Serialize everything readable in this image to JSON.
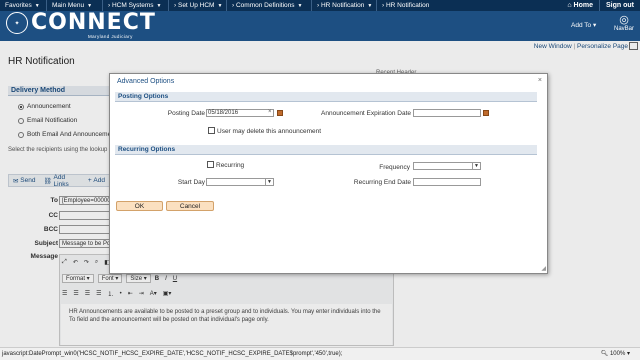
{
  "topnav": {
    "crumbs": [
      "Favorites",
      "Main Menu",
      "HCM Systems",
      "Set Up HCM",
      "Common Definitions",
      "HR Notification",
      "HR Notification"
    ],
    "home": "Home",
    "signout": "Sign out"
  },
  "banner": {
    "logo_text": "CONNECT",
    "logo_sub": "Maryland Judiciary",
    "add_to": "Add To",
    "navbar": "NavBar"
  },
  "links": {
    "new_window": "New Window",
    "personalize": "Personalize Page"
  },
  "page": {
    "title": "HR Notification",
    "delivery_method": "Delivery Method",
    "radio_announcement": "Announcement",
    "radio_email": "Email Notification",
    "radio_both": "Both Email And Announceme",
    "recipients_text": "Select the recipients using the lookup",
    "send": "Send",
    "add_links": "Add Links",
    "add": "Add",
    "to_label": "To",
    "to_value": "[Employee=00000",
    "cc_label": "CC",
    "bcc_label": "BCC",
    "subject_label": "Subject",
    "subject_value": "Message to be Po",
    "message_label": "Message",
    "editor": {
      "format": "Format",
      "font": "Font",
      "size": "Size",
      "body": "HR Announcements are available to be posted to a preset group and to individuals. You may enter individuals into the To field and the announcement will be posted on that individual's page only."
    },
    "partial_header": "Recent Header"
  },
  "modal": {
    "title": "Advanced Options",
    "close": "×",
    "posting_section": "Posting Options",
    "posting_date_label": "Posting Date",
    "posting_date_value": "05/18/2016",
    "expiration_label": "Announcement Expiration Date",
    "expiration_value": "",
    "user_delete_label": "User may delete this announcement",
    "recurring_section": "Recurring Options",
    "recurring_label": "Recurring",
    "frequency_label": "Frequency",
    "start_day_label": "Start Day",
    "end_date_label": "Recurring End Date",
    "ok": "OK",
    "cancel": "Cancel"
  },
  "status": {
    "text": "javascript:DatePrompt_win0('HCSC_NOTIF_HCSC_EXPIRE_DATE','HCSC_NOTIF_HCSC_EXPIRE_DATE$prompt','450',true);",
    "zoom": "100%"
  }
}
